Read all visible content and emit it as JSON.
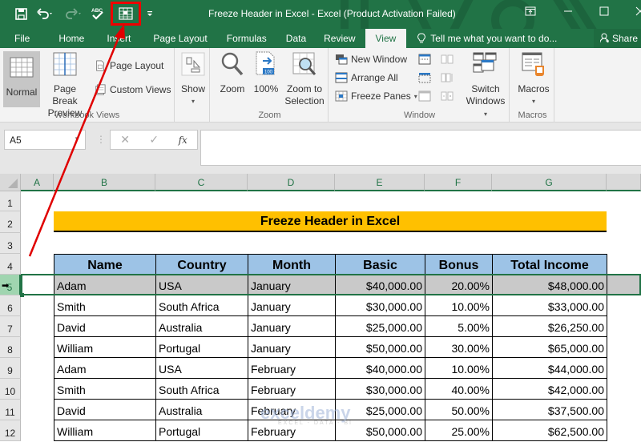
{
  "window": {
    "title": "Freeze Header in Excel - Excel (Product Activation Failed)",
    "controls": [
      "ribbon-display-options",
      "minimize",
      "maximize",
      "close"
    ]
  },
  "quick_access": {
    "items": [
      {
        "name": "save",
        "icon": "save-icon"
      },
      {
        "name": "undo",
        "icon": "undo-icon"
      },
      {
        "name": "redo",
        "icon": "redo-icon",
        "disabled": true
      },
      {
        "name": "spelling",
        "icon": "spelling-abc-icon",
        "label": "ABC"
      },
      {
        "name": "freeze-panes",
        "icon": "freeze-panes-icon",
        "highlighted": true
      },
      {
        "name": "customize",
        "icon": "customize-qat-icon"
      }
    ]
  },
  "tabs": [
    {
      "label": "File"
    },
    {
      "label": "Home"
    },
    {
      "label": "Insert"
    },
    {
      "label": "Page Layout"
    },
    {
      "label": "Formulas"
    },
    {
      "label": "Data"
    },
    {
      "label": "Review"
    },
    {
      "label": "View",
      "active": true
    }
  ],
  "tell_me": "Tell me what you want to do...",
  "share_label": "Share",
  "ribbon": {
    "workbook_views": {
      "label": "Workbook Views",
      "normal": "Normal",
      "page_break_1": "Page Break",
      "page_break_2": "Preview",
      "page_layout": "Page Layout",
      "custom_views": "Custom Views"
    },
    "show": {
      "label": "Show"
    },
    "zoom": {
      "label": "Zoom",
      "zoom": "Zoom",
      "hundred": "100%",
      "hundred_badge": "100",
      "zoom_sel_1": "Zoom to",
      "zoom_sel_2": "Selection"
    },
    "window": {
      "label": "Window",
      "new_window": "New Window",
      "arrange_all": "Arrange All",
      "freeze_panes": "Freeze Panes",
      "switch_1": "Switch",
      "switch_2": "Windows"
    },
    "macros": {
      "label": "Macros",
      "macros": "Macros"
    }
  },
  "formula_bar": {
    "name_box": "A5",
    "cancel": "✕",
    "enter": "✓",
    "fx": "fx",
    "formula": ""
  },
  "columns": [
    "A",
    "B",
    "C",
    "D",
    "E",
    "F",
    "G"
  ],
  "rows": [
    "1",
    "2",
    "3",
    "4",
    "5",
    "6",
    "7",
    "8",
    "9",
    "10",
    "11",
    "12"
  ],
  "selected_row": "5",
  "sheet": {
    "banner": "Freeze Header in Excel",
    "headers": [
      "Name",
      "Country",
      "Month",
      "Basic",
      "Bonus",
      "Total Income"
    ],
    "data": [
      [
        "Adam",
        "USA",
        "January",
        "$40,000.00",
        "20.00%",
        "$48,000.00"
      ],
      [
        "Smith",
        "South Africa",
        "January",
        "$30,000.00",
        "10.00%",
        "$33,000.00"
      ],
      [
        "David",
        "Australia",
        "January",
        "$25,000.00",
        "5.00%",
        "$26,250.00"
      ],
      [
        "William",
        "Portugal",
        "January",
        "$50,000.00",
        "30.00%",
        "$65,000.00"
      ],
      [
        "Adam",
        "USA",
        "February",
        "$40,000.00",
        "10.00%",
        "$44,000.00"
      ],
      [
        "Smith",
        "South Africa",
        "February",
        "$30,000.00",
        "40.00%",
        "$42,000.00"
      ],
      [
        "David",
        "Australia",
        "February",
        "$25,000.00",
        "50.00%",
        "$37,500.00"
      ],
      [
        "William",
        "Portugal",
        "February",
        "$50,000.00",
        "25.00%",
        "$62,500.00"
      ]
    ]
  },
  "watermark": {
    "brand": "exceldemy",
    "tagline": "EXCEL - DATA - BI"
  },
  "colors": {
    "excel_green": "#217346",
    "banner_fill": "#ffc000",
    "header_fill": "#9dc3e6",
    "selected_row_fill": "#c9c9c9",
    "annotation_red": "#e00000"
  }
}
